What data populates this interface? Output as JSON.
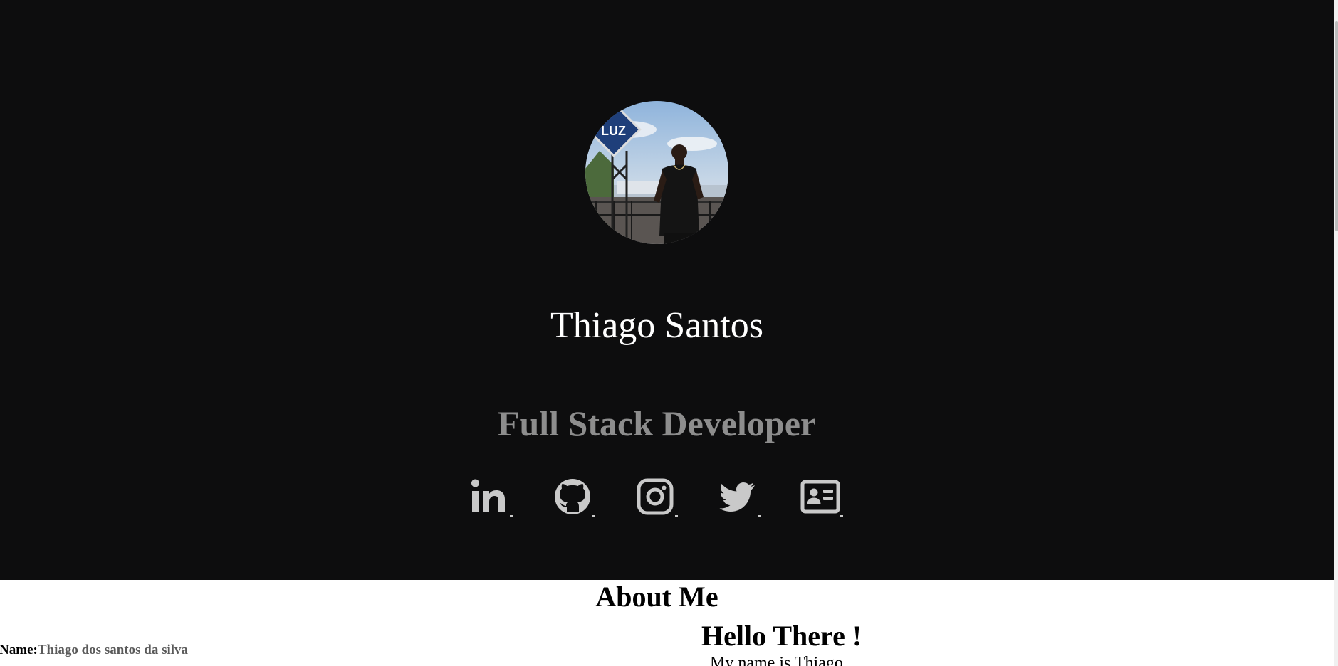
{
  "hero": {
    "name": "Thiago Santos",
    "role": "Full Stack Developer",
    "avatar_alt": "profile photo",
    "colors": {
      "background": "#0d0d0e",
      "name": "#ffffff",
      "role": "#8d8d8d",
      "icons": "#c9c9c9"
    }
  },
  "socials": [
    {
      "name": "LinkedIn",
      "icon": "linkedin-icon"
    },
    {
      "name": "GitHub",
      "icon": "github-icon"
    },
    {
      "name": "Instagram",
      "icon": "instagram-icon"
    },
    {
      "name": "Twitter",
      "icon": "twitter-icon"
    },
    {
      "name": "Contact card",
      "icon": "id-card-icon"
    }
  ],
  "about": {
    "title": "About Me",
    "detail_label": "l Name:",
    "detail_value": "Thiago dos santos da silva",
    "hello_title": "Hello There !",
    "hello_text": "My name is Thiago"
  }
}
